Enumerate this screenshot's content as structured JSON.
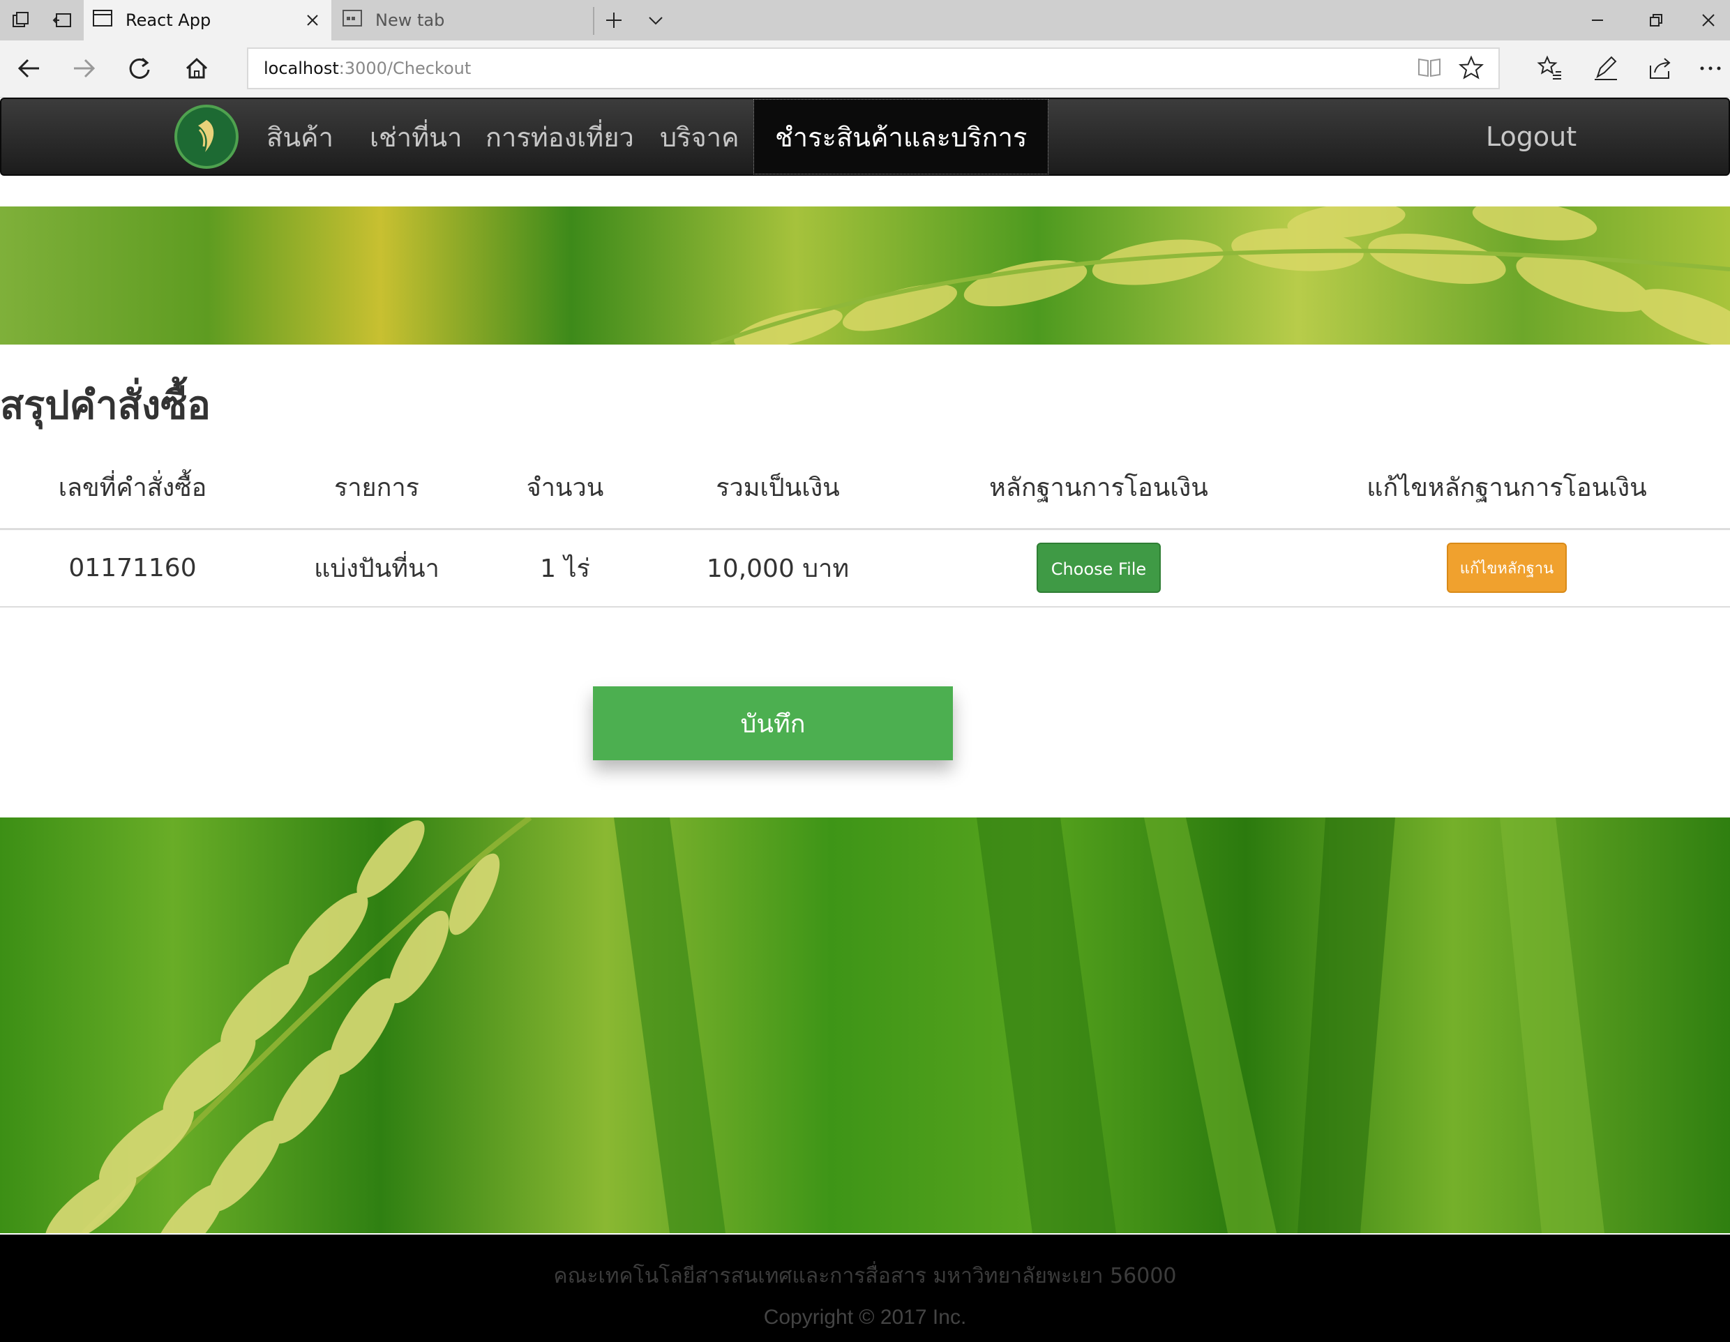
{
  "browser": {
    "tabs": [
      {
        "title": "React App",
        "active": true
      },
      {
        "title": "New tab",
        "active": false
      }
    ],
    "url_host": "localhost",
    "url_rest": ":3000/Checkout"
  },
  "nav": {
    "items": [
      "สินค้า",
      "เช่าที่นา",
      "การท่องเที่ยว",
      "บริจาค",
      "ชำระสินค้าและบริการ"
    ],
    "active_index": 4,
    "logout": "Logout"
  },
  "page": {
    "title": "สรุปคำสั่งซื้อ"
  },
  "table": {
    "headers": [
      "เลขที่คำสั่งซื้อ",
      "รายการ",
      "จำนวน",
      "รวมเป็นเงิน",
      "หลักฐานการโอนเงิน",
      "แก้ไขหลักฐานการโอนเงิน"
    ],
    "rows": [
      {
        "order_no": "01171160",
        "item": "แบ่งปันที่นา",
        "qty": "1 ไร่",
        "total": "10,000 บาท",
        "file_button": "Choose File",
        "edit_button": "แก้ไขหลักฐาน"
      }
    ]
  },
  "save_button": "บันทึก",
  "footer": {
    "line1": "คณะเทคโนโลยีสารสนเทศและการสื่อสาร มหาวิทยาลัยพะเยา 56000",
    "line2": "Copyright © 2017 Inc."
  },
  "colors": {
    "nav_bg": "#2a2a2a",
    "file_button": "#3f9a45",
    "edit_button": "#f0a12e",
    "save_button": "#4caf50",
    "footer_bg": "#000000"
  }
}
